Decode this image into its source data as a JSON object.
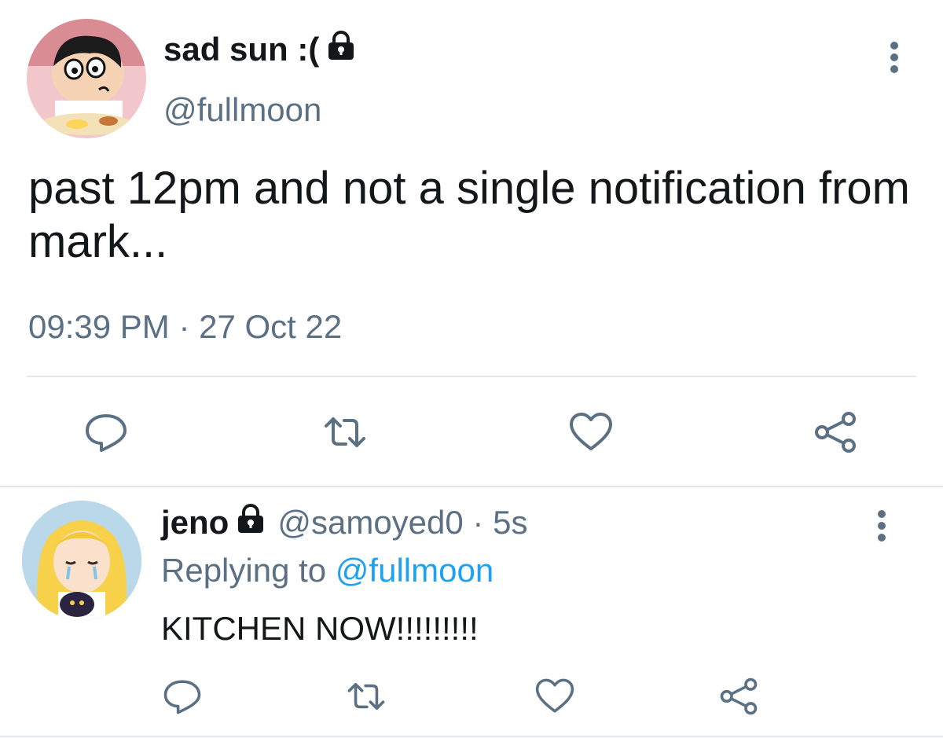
{
  "main_tweet": {
    "display_name": "sad sun :(",
    "handle": "@fullmoon",
    "text": "past 12pm and not a single notification from mark...",
    "timestamp": "09:39 PM · 27 Oct 22",
    "avatar_icon": "cartoon-boy-avatar",
    "lock_icon": "lock-icon",
    "actions": [
      "reply-icon",
      "retweet-icon",
      "like-icon",
      "share-icon"
    ]
  },
  "reply_tweet": {
    "display_name": "jeno",
    "handle_time": "@samoyed0 · 5s",
    "replying_prefix": "Replying to",
    "replying_mention": "@fullmoon",
    "text": "KITCHEN NOW!!!!!!!!!",
    "avatar_icon": "anime-girl-avatar",
    "lock_icon": "lock-icon",
    "actions": [
      "reply-icon",
      "retweet-icon",
      "like-icon",
      "share-icon"
    ]
  },
  "colors": {
    "text": "#14171a",
    "secondary": "#5b7083",
    "mention": "#1da1f2",
    "divider": "#e1e8ed"
  }
}
